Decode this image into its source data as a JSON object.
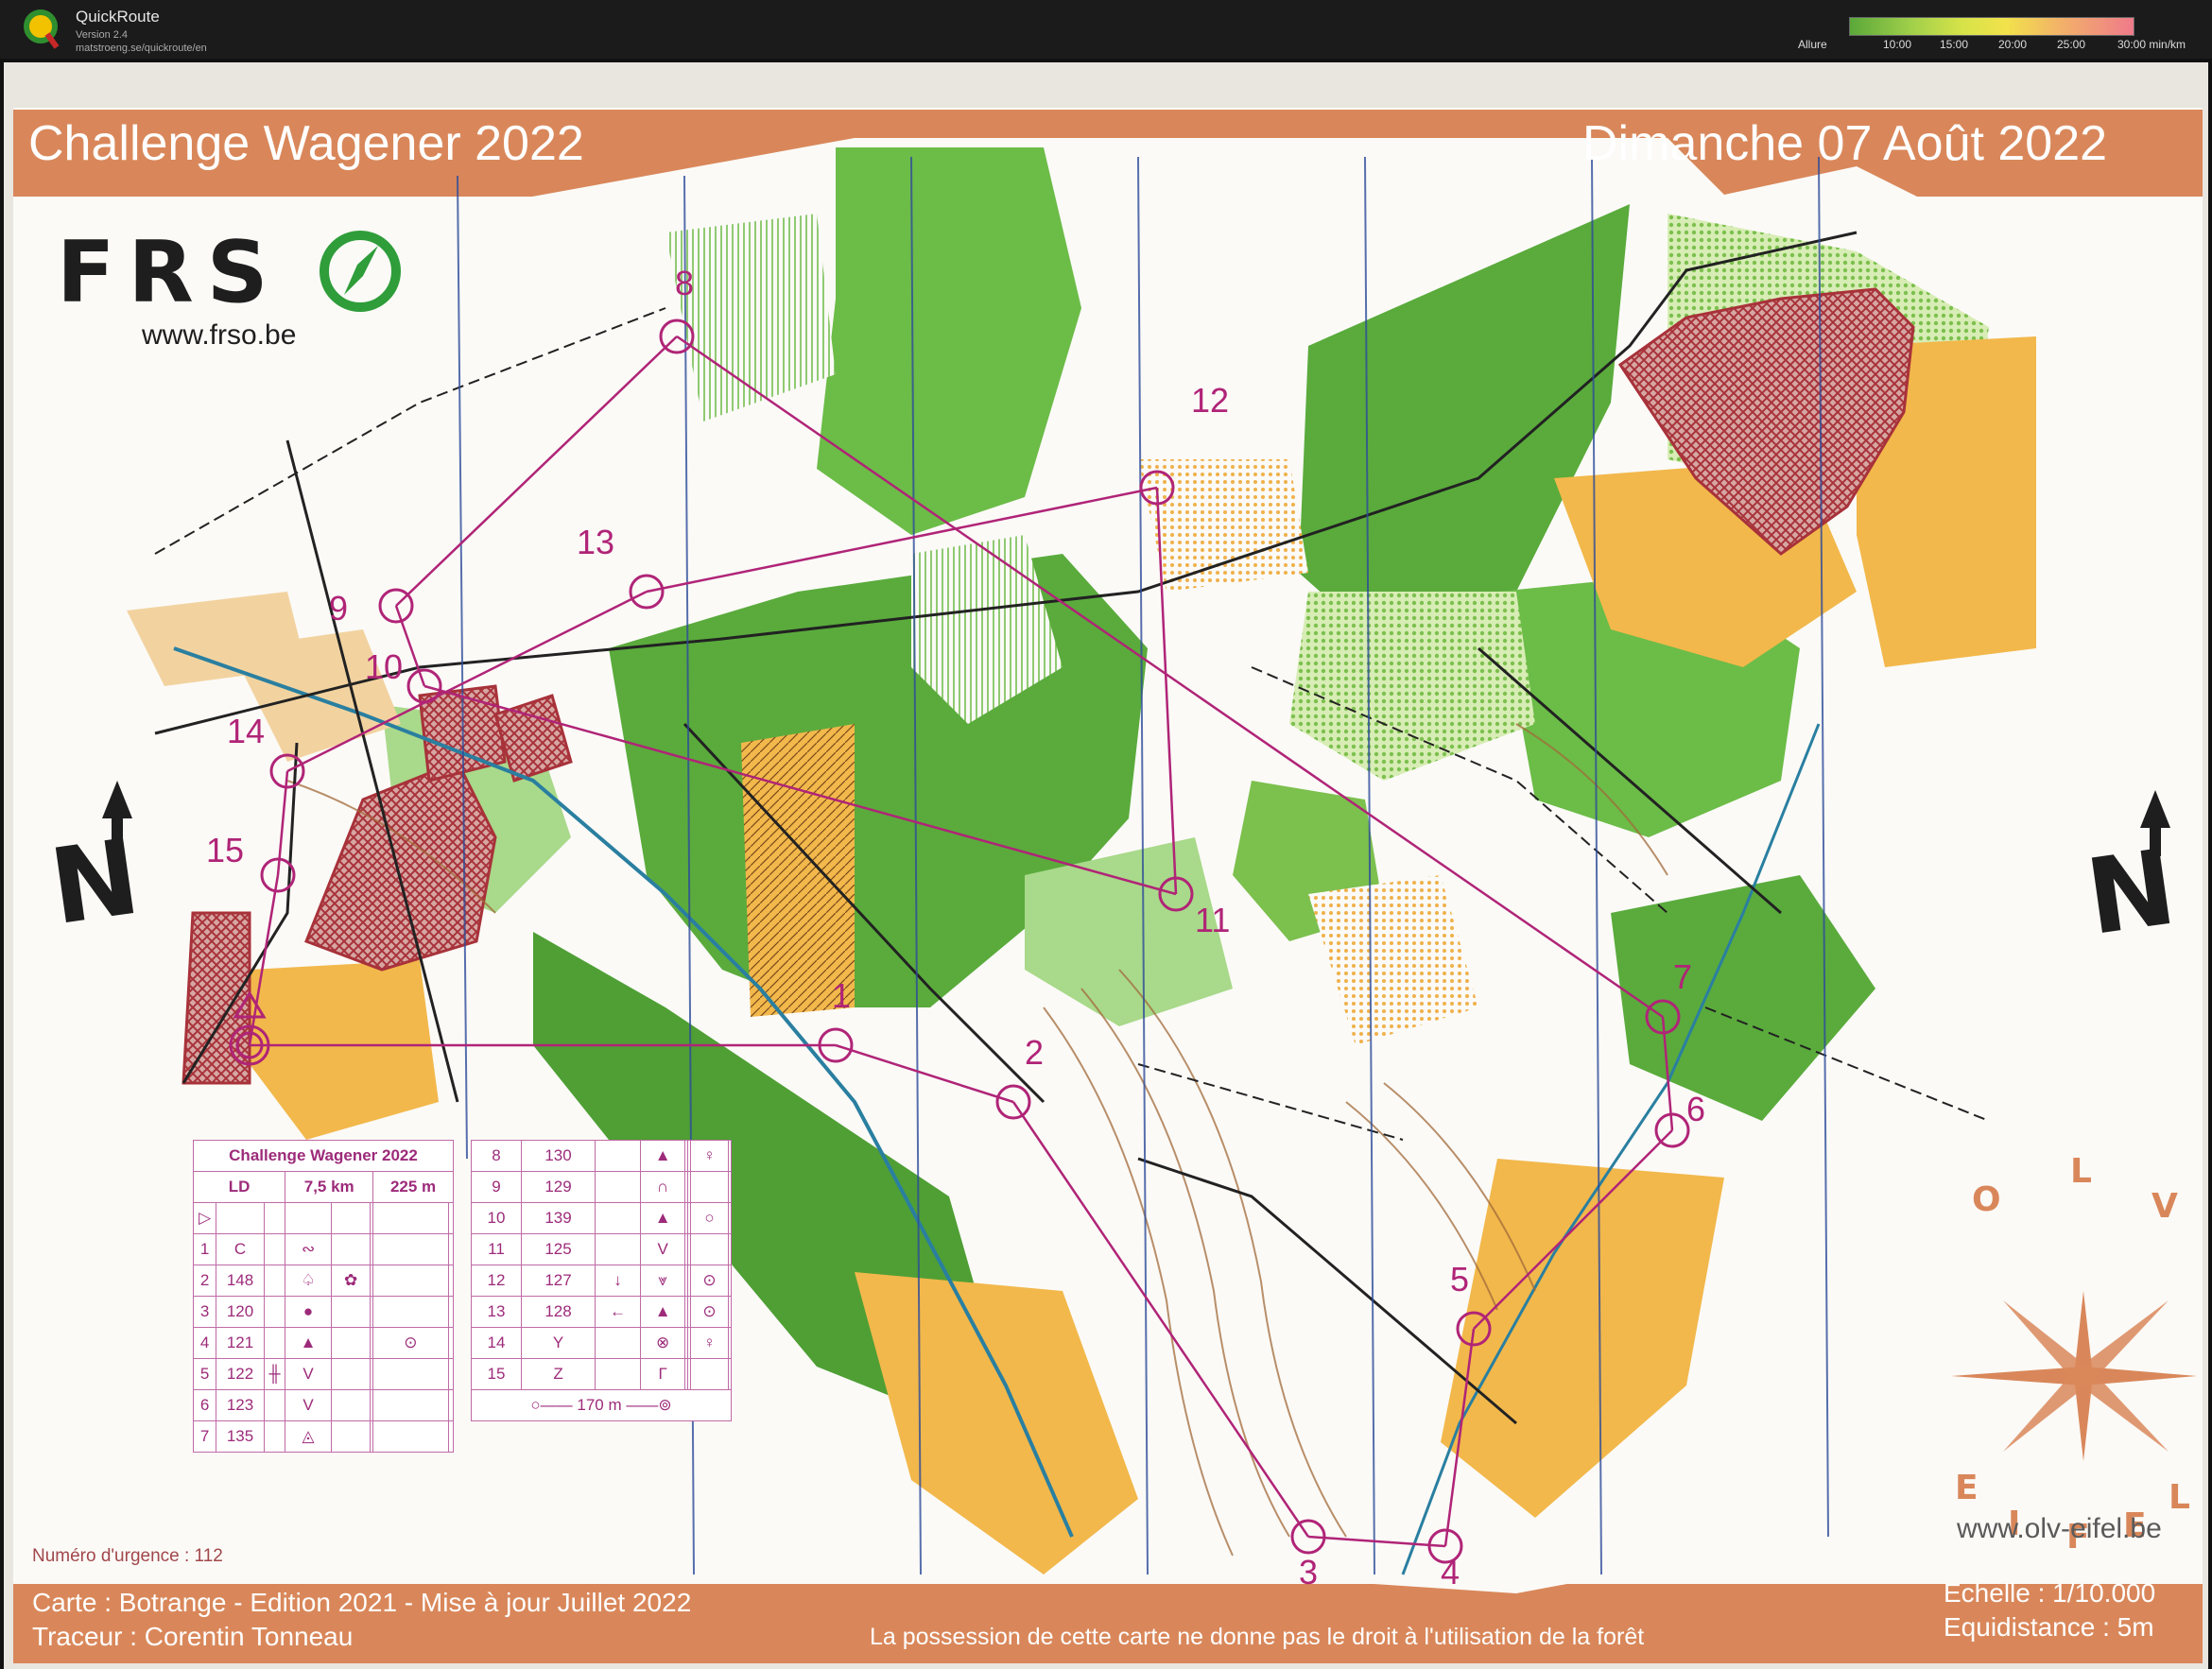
{
  "app": {
    "name": "QuickRoute",
    "version": "Version 2.4",
    "url": "matstroeng.se/quickroute/en",
    "pace_label": "Allure",
    "pace_ticks": [
      "10:00",
      "15:00",
      "20:00",
      "25:00",
      "30:00 min/km"
    ]
  },
  "map": {
    "title": "Challenge Wagener 2022",
    "date": "Dimanche 07 Août 2022",
    "federation": "FRS",
    "federation_url": "www.frso.be",
    "club_letters": [
      "O",
      "L",
      "V"
    ],
    "club_letters_bottom": [
      "E",
      "I",
      "F",
      "E",
      "L"
    ],
    "club_url": "www.olv-eifel.be",
    "north_letter": "N",
    "emergency": "Numéro d'urgence : 112",
    "footer": {
      "map_info": "Carte : Botrange - Edition 2021 - Mise à jour Juillet 2022",
      "setter": "Traceur : Corentin Tonneau",
      "notice": "La possession de cette carte ne donne pas le droit à l'utilisation de la forêt",
      "scale": "Echelle : 1/10.000",
      "contour": "Equidistance : 5m"
    },
    "control_numbers": [
      "1",
      "2",
      "3",
      "4",
      "5",
      "6",
      "7",
      "8",
      "9",
      "10",
      "11",
      "12",
      "13",
      "14",
      "15"
    ]
  },
  "control_description": {
    "title": "Challenge Wagener 2022",
    "category": "LD",
    "distance": "7,5 km",
    "climb": "225 m",
    "rows_left": [
      {
        "n": "1",
        "code": "C"
      },
      {
        "n": "2",
        "code": "148"
      },
      {
        "n": "3",
        "code": "120"
      },
      {
        "n": "4",
        "code": "121"
      },
      {
        "n": "5",
        "code": "122"
      },
      {
        "n": "6",
        "code": "123"
      },
      {
        "n": "7",
        "code": "135"
      }
    ],
    "rows_right": [
      {
        "n": "8",
        "code": "130"
      },
      {
        "n": "9",
        "code": "129"
      },
      {
        "n": "10",
        "code": "139"
      },
      {
        "n": "11",
        "code": "125"
      },
      {
        "n": "12",
        "code": "127"
      },
      {
        "n": "13",
        "code": "128"
      },
      {
        "n": "14",
        "code": "Y"
      },
      {
        "n": "15",
        "code": "Z"
      }
    ],
    "finish": "170 m"
  },
  "colors": {
    "band": "#d9875a",
    "forest": "#5aab3c",
    "open": "#f2b84b",
    "course": "#b02477",
    "oob": "#a8323a"
  }
}
